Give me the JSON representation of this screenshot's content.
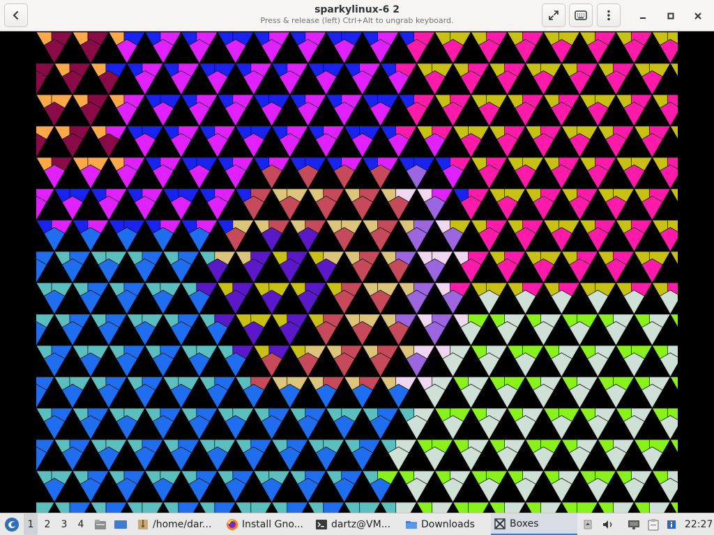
{
  "window": {
    "title": "sparkylinux-6 2",
    "subtitle": "Press & release (left) Ctrl+Alt to ungrab keyboard."
  },
  "header_buttons": [
    "back-icon",
    "fullscreen-icon",
    "keyboard-icon",
    "menu-icon"
  ],
  "window_controls": [
    "minimize-icon",
    "maximize-icon",
    "close-icon"
  ],
  "guest_display": {
    "content": "penrose-rhombus-tiling",
    "palette": [
      "#e020ff",
      "#1a22f0",
      "#ff1aaa",
      "#c8c013",
      "#c74a5a",
      "#dcc57a",
      "#5b18c8",
      "#9b66e0",
      "#f0d6f0",
      "#1f6ef0",
      "#5bbfc0",
      "#cfe0d6",
      "#88f21a",
      "#8a0a48",
      "#ffa84a"
    ]
  },
  "taskbar": {
    "workspaces": [
      "1",
      "2",
      "3",
      "4"
    ],
    "active_workspace": "1",
    "tasks": [
      {
        "label": "/home/dar...",
        "icon": "archive-icon"
      },
      {
        "label": "Install Gno...",
        "icon": "firefox-icon"
      },
      {
        "label": "dartz@VM...",
        "icon": "terminal-icon"
      },
      {
        "label": "Downloads",
        "icon": "folder-icon"
      },
      {
        "label": "Boxes",
        "icon": "boxes-icon",
        "active": true
      }
    ],
    "clock": "22:27"
  }
}
